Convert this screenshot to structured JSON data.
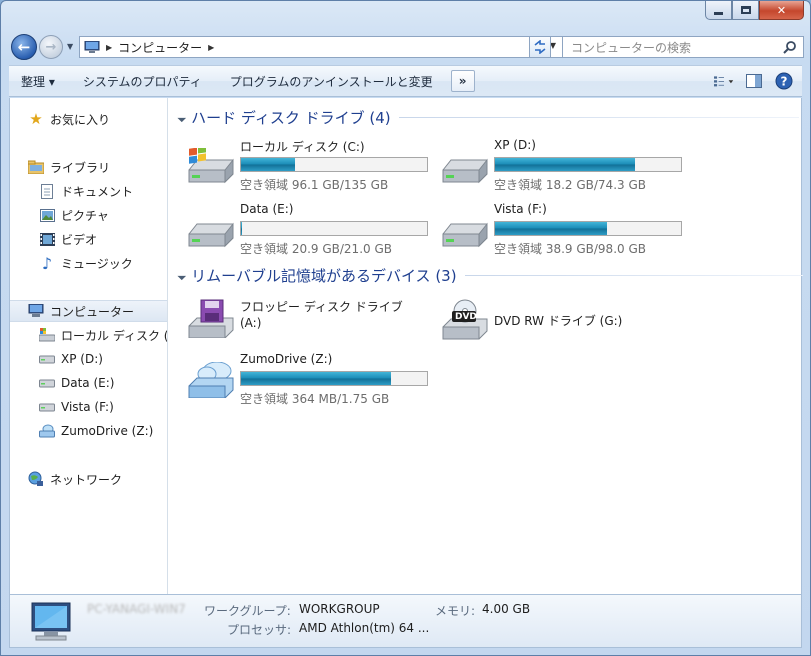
{
  "address": {
    "crumb": "コンピューター"
  },
  "search": {
    "placeholder": "コンピューターの検索"
  },
  "toolbar": {
    "organize": "整理 ▾",
    "system_properties": "システムのプロパティ",
    "uninstall": "プログラムのアンインストールと変更",
    "more": "»"
  },
  "nav": {
    "favorites": "お気に入り",
    "libraries": "ライブラリ",
    "documents": "ドキュメント",
    "pictures": "ピクチャ",
    "videos": "ビデオ",
    "music": "ミュージック",
    "computer": "コンピューター",
    "drive_c": "ローカル ディスク (C:)",
    "drive_d": "XP (D:)",
    "drive_e": "Data (E:)",
    "drive_f": "Vista (F:)",
    "drive_z": "ZumoDrive (Z:)",
    "network": "ネットワーク"
  },
  "groups": {
    "hdd": "ハード ディスク ドライブ (4)",
    "removable": "リムーバブル記憶域があるデバイス (3)"
  },
  "drives": [
    {
      "name": "ローカル ディスク (C:)",
      "free": "空き領域 96.1 GB/135 GB",
      "used_fraction": 0.288
    },
    {
      "name": "XP (D:)",
      "free": "空き領域 18.2 GB/74.3 GB",
      "used_fraction": 0.755
    },
    {
      "name": "Data (E:)",
      "free": "空き領域 20.9 GB/21.0 GB",
      "used_fraction": 0.005
    },
    {
      "name": "Vista (F:)",
      "free": "空き領域 38.9 GB/98.0 GB",
      "used_fraction": 0.603
    }
  ],
  "removable": {
    "floppy": "フロッピー ディスク ドライブ\n(A:)",
    "floppy_line1": "フロッピー ディスク ドライブ",
    "floppy_line2": "(A:)",
    "dvd": "DVD RW ドライブ (G:)",
    "dvd_badge": "DVD",
    "zumo_name": "ZumoDrive (Z:)",
    "zumo_free": "空き領域 364 MB/1.75 GB",
    "zumo_used_fraction": 0.804
  },
  "details": {
    "pc_name": "PC-YANAGI-WIN7",
    "workgroup_label": "ワークグループ:",
    "workgroup": "WORKGROUP",
    "memory_label": "メモリ:",
    "memory": "4.00 GB",
    "cpu_label": "プロセッサ:",
    "cpu": "AMD Athlon(tm) 64 ..."
  }
}
